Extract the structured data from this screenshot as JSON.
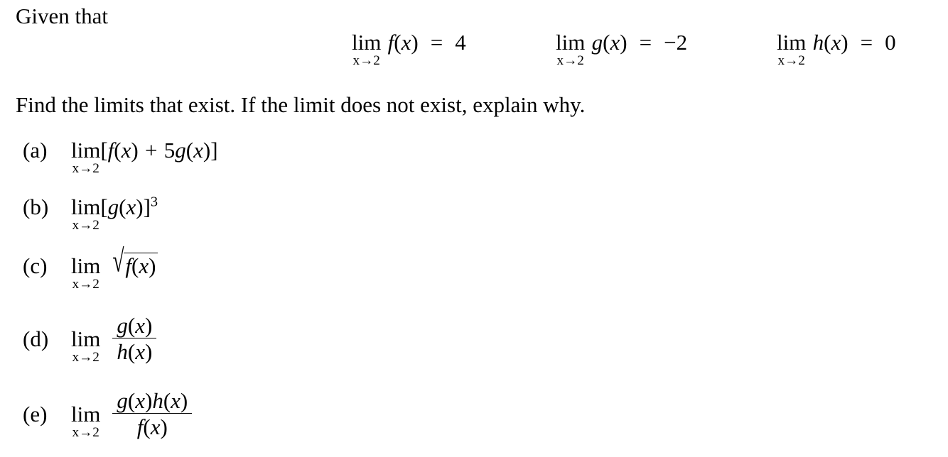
{
  "document": {
    "type": "math-problem",
    "background_color": "#ffffff",
    "text_color": "#000000",
    "intro_text": "Given that",
    "instruction_text": "Find the limits that exist. If the limit does not exist, explain why.",
    "limit_variable": "x",
    "limit_point": "2",
    "limit_operator": "lim",
    "limit_subscript": "x→2",
    "arrow_glyph": "→",
    "radical_glyph": "√",
    "given": [
      {
        "id": "given-f",
        "function": "f",
        "argument": "x",
        "equals": "=",
        "value": "4",
        "full_text": "lim x→2 f(x) = 4"
      },
      {
        "id": "given-g",
        "function": "g",
        "argument": "x",
        "equals": "=",
        "value": "−2",
        "full_text": "lim x→2 g(x) = −2"
      },
      {
        "id": "given-h",
        "function": "h",
        "argument": "x",
        "equals": "=",
        "value": "0",
        "full_text": "lim x→2 h(x) = 0"
      }
    ],
    "parts": [
      {
        "id": "part-a",
        "tag": "(a)",
        "form": "bracketed-sum",
        "open_bracket": "[",
        "close_bracket": "]",
        "term1_function": "f",
        "term1_argument": "x",
        "plus": "+",
        "coefficient": "5",
        "term2_function": "g",
        "term2_argument": "x",
        "full_text": "lim x→2 [f(x) + 5g(x)]"
      },
      {
        "id": "part-b",
        "tag": "(b)",
        "form": "bracketed-power",
        "open_bracket": "[",
        "close_bracket": "]",
        "base_function": "g",
        "base_argument": "x",
        "exponent": "3",
        "full_text": "lim x→2 [g(x)]³"
      },
      {
        "id": "part-c",
        "tag": "(c)",
        "form": "square-root",
        "radicand_function": "f",
        "radicand_argument": "x",
        "full_text": "lim x→2 √(f(x))"
      },
      {
        "id": "part-d",
        "tag": "(d)",
        "form": "fraction",
        "numerator_function": "g",
        "numerator_argument": "x",
        "denominator_function": "h",
        "denominator_argument": "x",
        "full_text": "lim x→2 g(x)/h(x)"
      },
      {
        "id": "part-e",
        "tag": "(e)",
        "form": "fraction-product",
        "numerator_function1": "g",
        "numerator_argument1": "x",
        "numerator_function2": "h",
        "numerator_argument2": "x",
        "denominator_function": "f",
        "denominator_argument": "x",
        "full_text": "lim x→2 g(x)h(x)/f(x)"
      }
    ],
    "paren": {
      "open": "(",
      "close": ")"
    }
  }
}
